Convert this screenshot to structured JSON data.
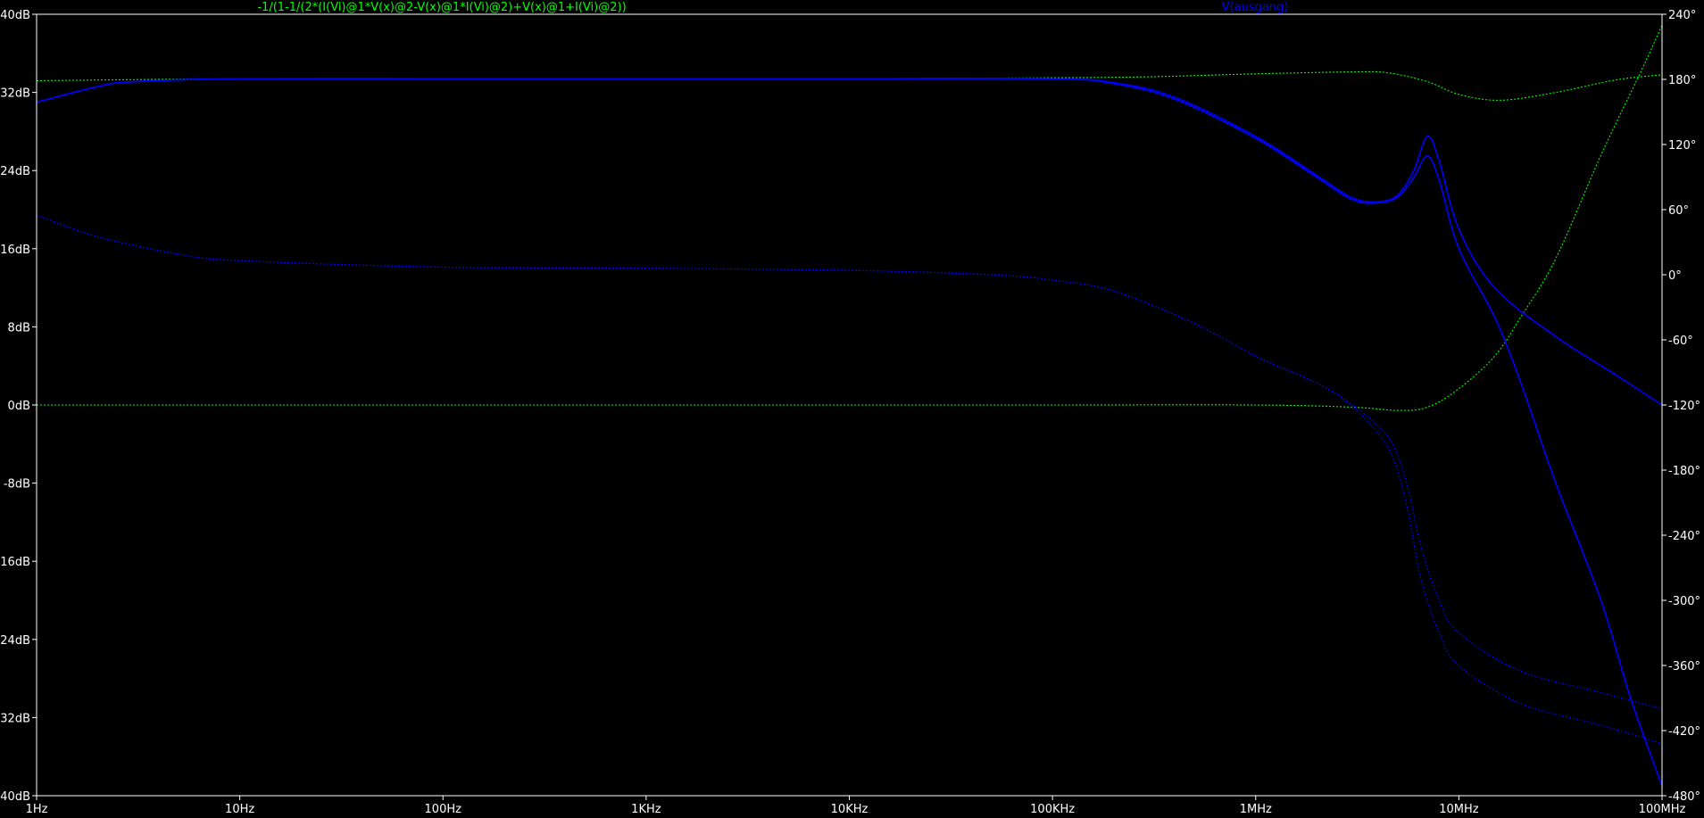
{
  "chart_data": {
    "type": "line",
    "title": "",
    "xscale": "log",
    "xlim": [
      1,
      100000000
    ],
    "x_ticks": [
      {
        "value": 1,
        "label": "1Hz"
      },
      {
        "value": 10,
        "label": "10Hz"
      },
      {
        "value": 100,
        "label": "100Hz"
      },
      {
        "value": 1000,
        "label": "1KHz"
      },
      {
        "value": 10000,
        "label": "10KHz"
      },
      {
        "value": 100000,
        "label": "100KHz"
      },
      {
        "value": 1000000,
        "label": "1MHz"
      },
      {
        "value": 10000000,
        "label": "10MHz"
      },
      {
        "value": 100000000,
        "label": "100MHz"
      }
    ],
    "ylim_left": [
      -40,
      40
    ],
    "y_ticks_left": [
      {
        "value": 40,
        "label": "40dB"
      },
      {
        "value": 32,
        "label": "32dB"
      },
      {
        "value": 24,
        "label": "24dB"
      },
      {
        "value": 16,
        "label": "16dB"
      },
      {
        "value": 8,
        "label": "8dB"
      },
      {
        "value": 0,
        "label": "0dB"
      },
      {
        "value": -8,
        "label": "-8dB"
      },
      {
        "value": -16,
        "label": "-16dB"
      },
      {
        "value": -24,
        "label": "-24dB"
      },
      {
        "value": -32,
        "label": "-32dB"
      },
      {
        "value": -40,
        "label": "-40dB"
      }
    ],
    "ylim_right": [
      -480,
      240
    ],
    "y_ticks_right": [
      {
        "value": 240,
        "label": "240°"
      },
      {
        "value": 180,
        "label": "180°"
      },
      {
        "value": 120,
        "label": "120°"
      },
      {
        "value": 60,
        "label": "60°"
      },
      {
        "value": 0,
        "label": "0°"
      },
      {
        "value": -60,
        "label": "-60°"
      },
      {
        "value": -120,
        "label": "-120°"
      },
      {
        "value": -180,
        "label": "-180°"
      },
      {
        "value": -240,
        "label": "-240°"
      },
      {
        "value": -300,
        "label": "-300°"
      },
      {
        "value": -360,
        "label": "-360°"
      },
      {
        "value": -420,
        "label": "-420°"
      },
      {
        "value": -480,
        "label": "-480°"
      }
    ],
    "grid": false,
    "colors": {
      "background": "#000000",
      "axis": "#ffffff",
      "green": "#00ff00",
      "blue": "#0000ff"
    },
    "trace_labels": [
      {
        "text": "-1/(1-1/(2*(I(Vi)@1*V(x)@2-V(x)@1*I(Vi)@2)+V(x)@1+I(Vi)@2))",
        "color": "#00ff00"
      },
      {
        "text": "V(ausgang)",
        "color": "#0000ff"
      }
    ],
    "series": [
      {
        "trace": 0,
        "quantity": "magnitude",
        "axis": "left",
        "style": "dotted",
        "points": [
          [
            1,
            33.2
          ],
          [
            10,
            33.4
          ],
          [
            100,
            33.4
          ],
          [
            1000,
            33.4
          ],
          [
            10000,
            33.4
          ],
          [
            100000,
            33.5
          ],
          [
            300000,
            33.6
          ],
          [
            1000000,
            33.9
          ],
          [
            3000000,
            34.1
          ],
          [
            4500000,
            34.0
          ],
          [
            7000000,
            33.1
          ],
          [
            10000000,
            31.8
          ],
          [
            16000000,
            31.2
          ],
          [
            30000000,
            32.0
          ],
          [
            60000000,
            33.3
          ],
          [
            100000000,
            33.8
          ]
        ]
      },
      {
        "trace": 0,
        "quantity": "phase",
        "axis": "right",
        "style": "dotted",
        "points": [
          [
            1,
            -120
          ],
          [
            10,
            -120
          ],
          [
            100,
            -120
          ],
          [
            1000,
            -120
          ],
          [
            10000,
            -120
          ],
          [
            100000,
            -120
          ],
          [
            1000000,
            -120
          ],
          [
            3000000,
            -122
          ],
          [
            5000000,
            -125
          ],
          [
            7000000,
            -122
          ],
          [
            10000000,
            -105
          ],
          [
            15000000,
            -75
          ],
          [
            20000000,
            -40
          ],
          [
            30000000,
            15
          ],
          [
            50000000,
            110
          ],
          [
            80000000,
            190
          ],
          [
            100000000,
            230
          ]
        ]
      },
      {
        "trace": 1,
        "quantity": "magnitude",
        "axis": "left",
        "style": "solid",
        "points": [
          [
            1,
            31.0
          ],
          [
            2,
            32.6
          ],
          [
            3,
            33.1
          ],
          [
            10,
            33.4
          ],
          [
            100,
            33.4
          ],
          [
            1000,
            33.4
          ],
          [
            10000,
            33.4
          ],
          [
            100000,
            33.4
          ],
          [
            200000,
            33.0
          ],
          [
            400000,
            31.5
          ],
          [
            1000000,
            27.5
          ],
          [
            2000000,
            23.5
          ],
          [
            3000000,
            21.2
          ],
          [
            4000000,
            20.8
          ],
          [
            5000000,
            21.5
          ],
          [
            6000000,
            24.0
          ],
          [
            7000000,
            27.5
          ],
          [
            8000000,
            25.0
          ],
          [
            10000000,
            18.0
          ],
          [
            15000000,
            12.0
          ],
          [
            30000000,
            7.0
          ],
          [
            60000000,
            3.0
          ],
          [
            100000000,
            0.0
          ]
        ]
      },
      {
        "trace": 1,
        "quantity": "magnitude",
        "axis": "left",
        "style": "solid",
        "points": [
          [
            1,
            31.0
          ],
          [
            2,
            32.6
          ],
          [
            3,
            33.1
          ],
          [
            10,
            33.4
          ],
          [
            100,
            33.4
          ],
          [
            1000,
            33.4
          ],
          [
            10000,
            33.4
          ],
          [
            100000,
            33.4
          ],
          [
            200000,
            32.9
          ],
          [
            400000,
            31.3
          ],
          [
            1000000,
            27.3
          ],
          [
            2000000,
            23.3
          ],
          [
            3000000,
            21.0
          ],
          [
            4000000,
            20.7
          ],
          [
            5000000,
            21.3
          ],
          [
            6000000,
            23.3
          ],
          [
            7000000,
            25.5
          ],
          [
            8000000,
            23.0
          ],
          [
            10000000,
            16.0
          ],
          [
            15000000,
            9.0
          ],
          [
            20000000,
            2.5
          ],
          [
            30000000,
            -8.0
          ],
          [
            50000000,
            -20.0
          ],
          [
            70000000,
            -30.0
          ],
          [
            100000000,
            -39.0
          ]
        ]
      },
      {
        "trace": 1,
        "quantity": "phase",
        "axis": "right",
        "style": "dotted",
        "points": [
          [
            1,
            55
          ],
          [
            2,
            35
          ],
          [
            5,
            19
          ],
          [
            10,
            13
          ],
          [
            100,
            7
          ],
          [
            1000,
            6
          ],
          [
            10000,
            4
          ],
          [
            50000,
            0
          ],
          [
            100000,
            -5
          ],
          [
            200000,
            -15
          ],
          [
            500000,
            -45
          ],
          [
            1000000,
            -75
          ],
          [
            2000000,
            -100
          ],
          [
            3000000,
            -120
          ],
          [
            4500000,
            -150
          ],
          [
            5500000,
            -190
          ],
          [
            6500000,
            -250
          ],
          [
            8000000,
            -300
          ],
          [
            10000000,
            -330
          ],
          [
            20000000,
            -365
          ],
          [
            50000000,
            -385
          ],
          [
            100000000,
            -400
          ]
        ]
      },
      {
        "trace": 1,
        "quantity": "phase",
        "axis": "right",
        "style": "dotted",
        "points": [
          [
            1,
            55
          ],
          [
            2,
            35
          ],
          [
            5,
            19
          ],
          [
            10,
            13
          ],
          [
            100,
            7
          ],
          [
            1000,
            6
          ],
          [
            10000,
            4
          ],
          [
            50000,
            0
          ],
          [
            100000,
            -5
          ],
          [
            200000,
            -15
          ],
          [
            500000,
            -45
          ],
          [
            1000000,
            -75
          ],
          [
            2000000,
            -100
          ],
          [
            3000000,
            -122
          ],
          [
            4500000,
            -160
          ],
          [
            5500000,
            -210
          ],
          [
            6500000,
            -280
          ],
          [
            8000000,
            -330
          ],
          [
            10000000,
            -360
          ],
          [
            20000000,
            -395
          ],
          [
            50000000,
            -415
          ],
          [
            100000000,
            -432
          ]
        ]
      }
    ]
  }
}
